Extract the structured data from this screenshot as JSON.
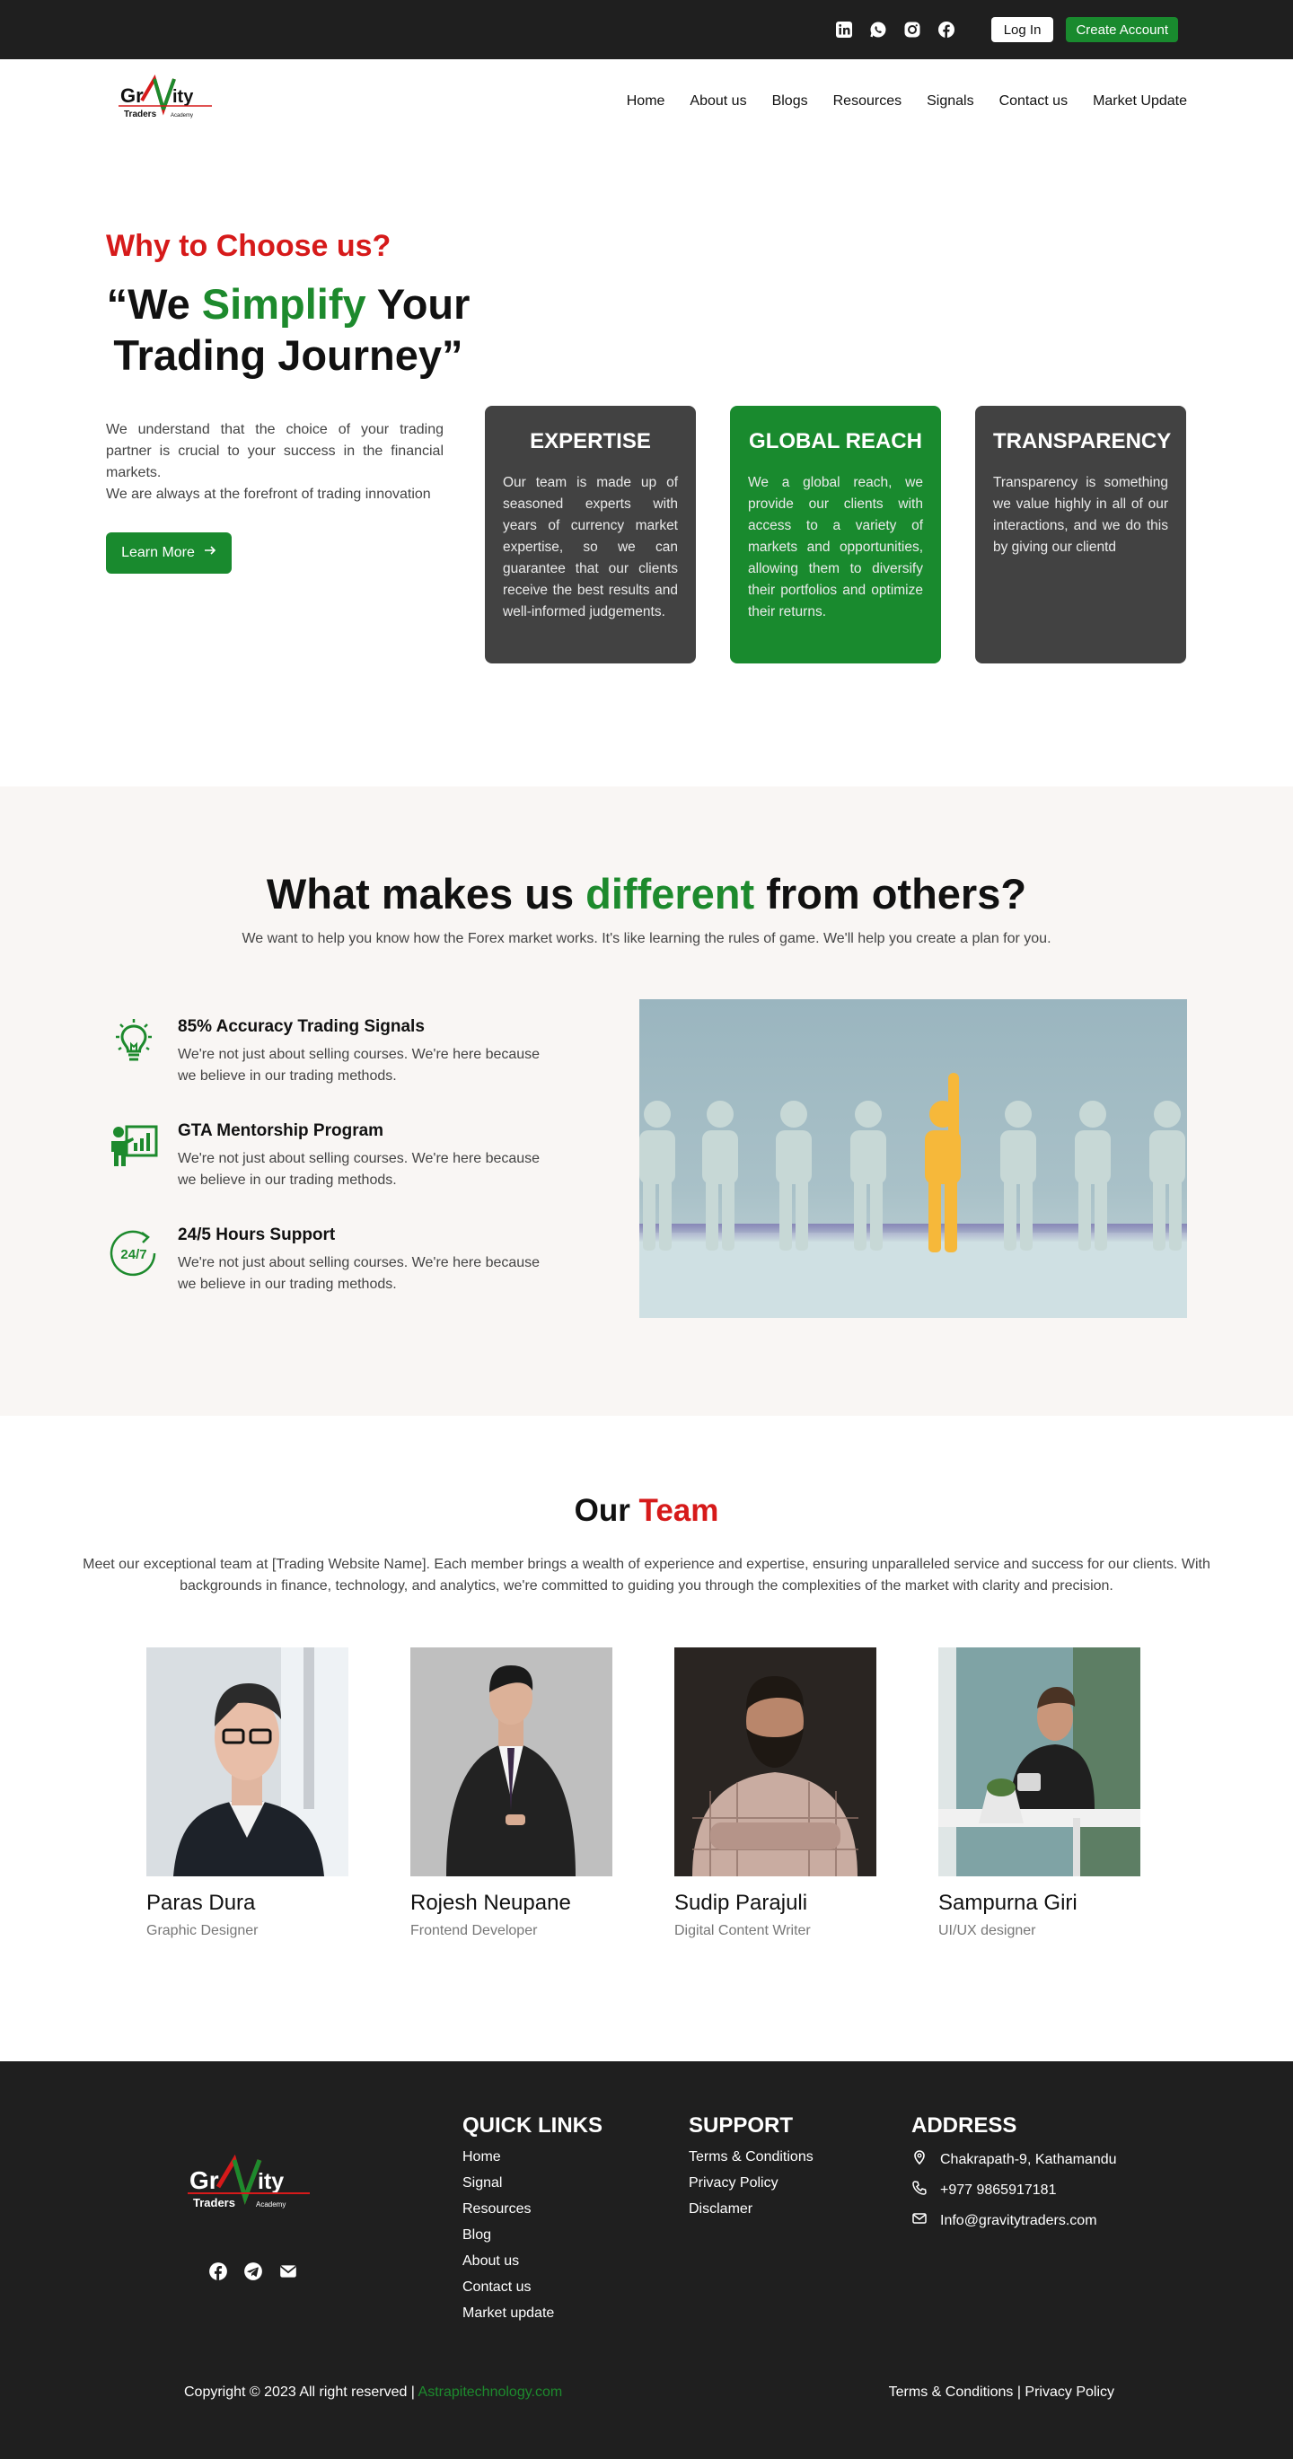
{
  "topbar": {
    "social_icons": [
      "linkedin-icon",
      "whatsapp-icon",
      "instagram-icon",
      "facebook-icon"
    ],
    "login_label": "Log In",
    "create_label": "Create Account"
  },
  "brand": {
    "logo_text_left": "Gr",
    "logo_text_right": "ity",
    "logo_sub1": "Traders",
    "logo_sub2": "Academy"
  },
  "nav": {
    "items": [
      "Home",
      "About us",
      "Blogs",
      "Resources",
      "Signals",
      "Contact us",
      "Market Update"
    ]
  },
  "hero": {
    "kicker": "Why to Choose us?",
    "headline_pre": "“We ",
    "headline_accent": "Simplify",
    "headline_post": " Your Trading Journey”",
    "para1": "We understand that the choice of your trading partner is crucial to your success in the financial markets.",
    "para2": "We are always at the forefront of trading innovation",
    "cta": "Learn More",
    "cards": [
      {
        "title": "EXPERTISE",
        "text": "Our team is made up of seasoned experts with years of currency market expertise, so we can guarantee that our clients receive the best results and well-informed judgements."
      },
      {
        "title": "GLOBAL REACH",
        "text": "We a global reach, we provide our clients with access to a variety of markets and opportunities, allowing them to diversify their portfolios and optimize their returns."
      },
      {
        "title": "TRANSPARENCY",
        "text": "Transparency is something we value highly in all of our interactions, and we do this by giving our clientd"
      }
    ]
  },
  "different": {
    "title_pre": "What makes us ",
    "title_accent": "different",
    "title_post": " from others?",
    "subtitle": "We want to help you know how the Forex market works. It's like learning the rules of game. We'll help you create a plan for you.",
    "features": [
      {
        "icon": "lightbulb-icon",
        "title": "85% Accuracy Trading Signals",
        "text": "We're not just about selling courses. We're here because we believe in our trading methods."
      },
      {
        "icon": "mentor-board-icon",
        "title": "GTA Mentorship Program",
        "text": "We're not just about selling courses. We're here because we believe in our trading methods."
      },
      {
        "icon": "support-24-7-icon",
        "title": "24/5 Hours Support",
        "text": "We're not just about selling courses. We're here because we believe in our trading methods."
      }
    ],
    "clock_label": "24/7"
  },
  "team": {
    "title_pre": "Our ",
    "title_accent": "Team",
    "intro": "Meet our exceptional team at [Trading Website Name]. Each member brings a wealth of experience and expertise, ensuring unparalleled service and success for our clients. With backgrounds in finance, technology, and analytics, we're committed to guiding you through the complexities of the market with clarity and precision.",
    "members": [
      {
        "name": "Paras Dura",
        "role": "Graphic Designer"
      },
      {
        "name": "Rojesh Neupane",
        "role": "Frontend Developer"
      },
      {
        "name": "Sudip Parajuli",
        "role": "Digital Content Writer"
      },
      {
        "name": "Sampurna Giri",
        "role": "UI/UX designer"
      }
    ]
  },
  "footer": {
    "social_icons": [
      "facebook-icon",
      "telegram-icon",
      "mail-icon"
    ],
    "quick_links_title": "QUICK LINKS",
    "quick_links": [
      "Home",
      "Signal",
      "Resources",
      "Blog",
      "About us",
      "Contact us",
      "Market update"
    ],
    "support_title": "SUPPORT",
    "support_links": [
      "Terms & Conditions",
      "Privacy Policy",
      "Disclamer"
    ],
    "address_title": "ADDRESS",
    "address": {
      "location": "Chakrapath-9, Kathamandu",
      "phone": "+977 9865917181",
      "email": "Info@gravitytraders.com"
    },
    "copyright": "Copyright © 2023 All right reserved | ",
    "copyright_link": "Astrapitechnology.com",
    "bottom_terms": "Terms & Conditions",
    "bottom_sep": " | ",
    "bottom_privacy": "Privacy Policy"
  },
  "colors": {
    "accent_green": "#198a2e",
    "accent_red": "#d61a1a",
    "dark": "#1f1f1f"
  }
}
